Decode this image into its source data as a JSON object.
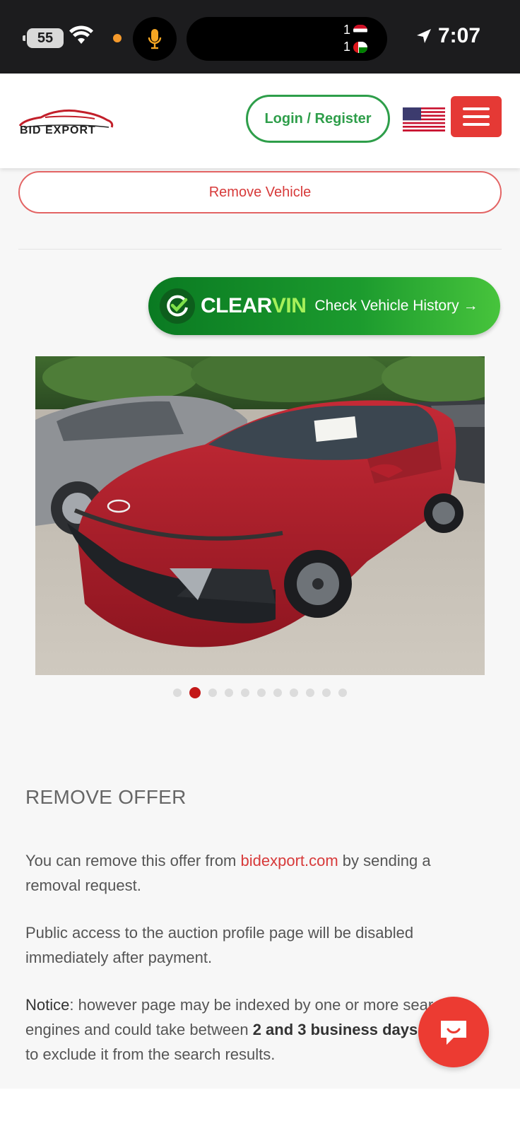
{
  "status_bar": {
    "battery": "55",
    "time": "7:07",
    "island_counts": [
      "1",
      "1"
    ]
  },
  "header": {
    "logo_text": "BID EXPORT",
    "login_label": "Login / Register"
  },
  "vehicle": {
    "remove_vehicle_label": "Remove Vehicle",
    "clearvin": {
      "brand_clear": "CLEAR",
      "brand_vin": "VIN",
      "cta": "Check Vehicle History",
      "arrow": "→"
    },
    "gallery": {
      "total_slides": 11,
      "active_index": 1
    }
  },
  "remove_offer": {
    "title": "REMOVE OFFER",
    "p1_before": "You can remove this offer from ",
    "p1_link": "bidexport.com",
    "p1_after": " by sending a removal request.",
    "p2": "Public access to the auction profile page will be disabled immediately after payment.",
    "p3_label": "Notice",
    "p3_a": ": however page may be indexed by one or more search engines and could take between ",
    "p3_bold": "2 and 3 business days",
    "p3_b": " in order to exclude it from the search results."
  },
  "colors": {
    "brand_red": "#e53935",
    "login_green": "#2e9e4a",
    "clearvin_green": "#1c9b2e",
    "dot_active": "#c31818"
  },
  "icons": [
    "battery-icon",
    "wifi-icon",
    "mic-icon",
    "location-arrow-icon",
    "us-flag-icon",
    "hamburger-menu-icon",
    "checkmark-icon",
    "chat-icon"
  ]
}
